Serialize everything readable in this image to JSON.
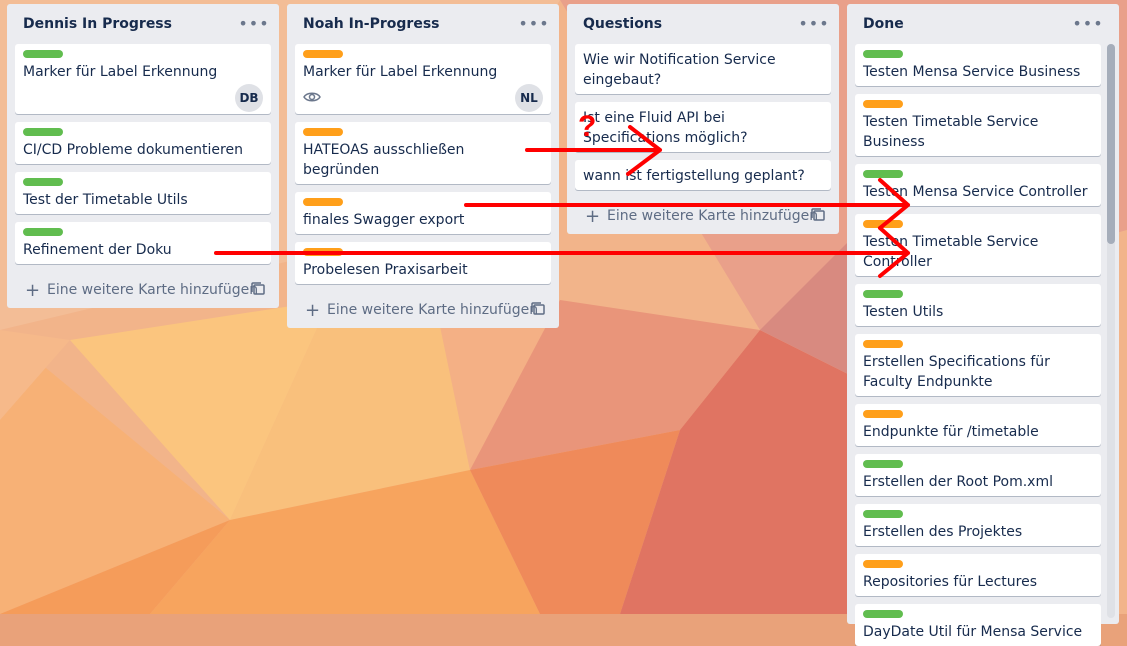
{
  "lists": [
    {
      "title": "Dennis In Progress",
      "cards": [
        {
          "label": "green",
          "title": "Marker für Label Erkennung",
          "avatar": "DB"
        },
        {
          "label": "green",
          "title": "CI/CD Probleme dokumentieren"
        },
        {
          "label": "green",
          "title": "Test der Timetable Utils"
        },
        {
          "label": "green",
          "title": "Refinement der Doku"
        }
      ],
      "add_label": "Eine weitere Karte hinzufügen"
    },
    {
      "title": "Noah In-Progress",
      "cards": [
        {
          "label": "orange",
          "title": "Marker für Label Erkennung",
          "avatar": "NL",
          "watch": true
        },
        {
          "label": "orange",
          "title": "HATEOAS ausschließen begründen"
        },
        {
          "label": "orange",
          "title": "finales Swagger export"
        },
        {
          "label": "orange",
          "title": "Probelesen Praxisarbeit"
        }
      ],
      "add_label": "Eine weitere Karte hinzufügen"
    },
    {
      "title": "Questions",
      "cards": [
        {
          "title": "Wie wir Notification Service eingebaut?"
        },
        {
          "title": "Ist eine Fluid API bei Specifications möglich?"
        },
        {
          "title": "wann ist fertigstellung geplant?"
        }
      ],
      "add_label": "Eine weitere Karte hinzufügen"
    },
    {
      "title": "Done",
      "cards": [
        {
          "label": "green",
          "title": "Testen Mensa Service Business"
        },
        {
          "label": "orange",
          "title": "Testen Timetable Service Business"
        },
        {
          "label": "green",
          "title": "Testen Mensa Service Controller"
        },
        {
          "label": "orange",
          "title": "Testen Timetable Service Controller"
        },
        {
          "label": "green",
          "title": "Testen Utils"
        },
        {
          "label": "orange",
          "title": "Erstellen Specifications für Faculty Endpunkte"
        },
        {
          "label": "orange",
          "title": "Endpunkte für /timetable"
        },
        {
          "label": "green",
          "title": "Erstellen der Root Pom.xml"
        },
        {
          "label": "green",
          "title": "Erstellen des Projektes"
        },
        {
          "label": "orange",
          "title": "Repositories für Lectures"
        },
        {
          "label": "green",
          "title": "DayDate Util für Mensa Service"
        }
      ]
    }
  ],
  "annotations": {
    "question_mark": "?",
    "arrow_color": "#ff0000"
  },
  "icons": {
    "list_menu": "ellipsis-icon",
    "add": "plus-icon",
    "template": "card-template-icon",
    "watch": "eye-icon"
  }
}
